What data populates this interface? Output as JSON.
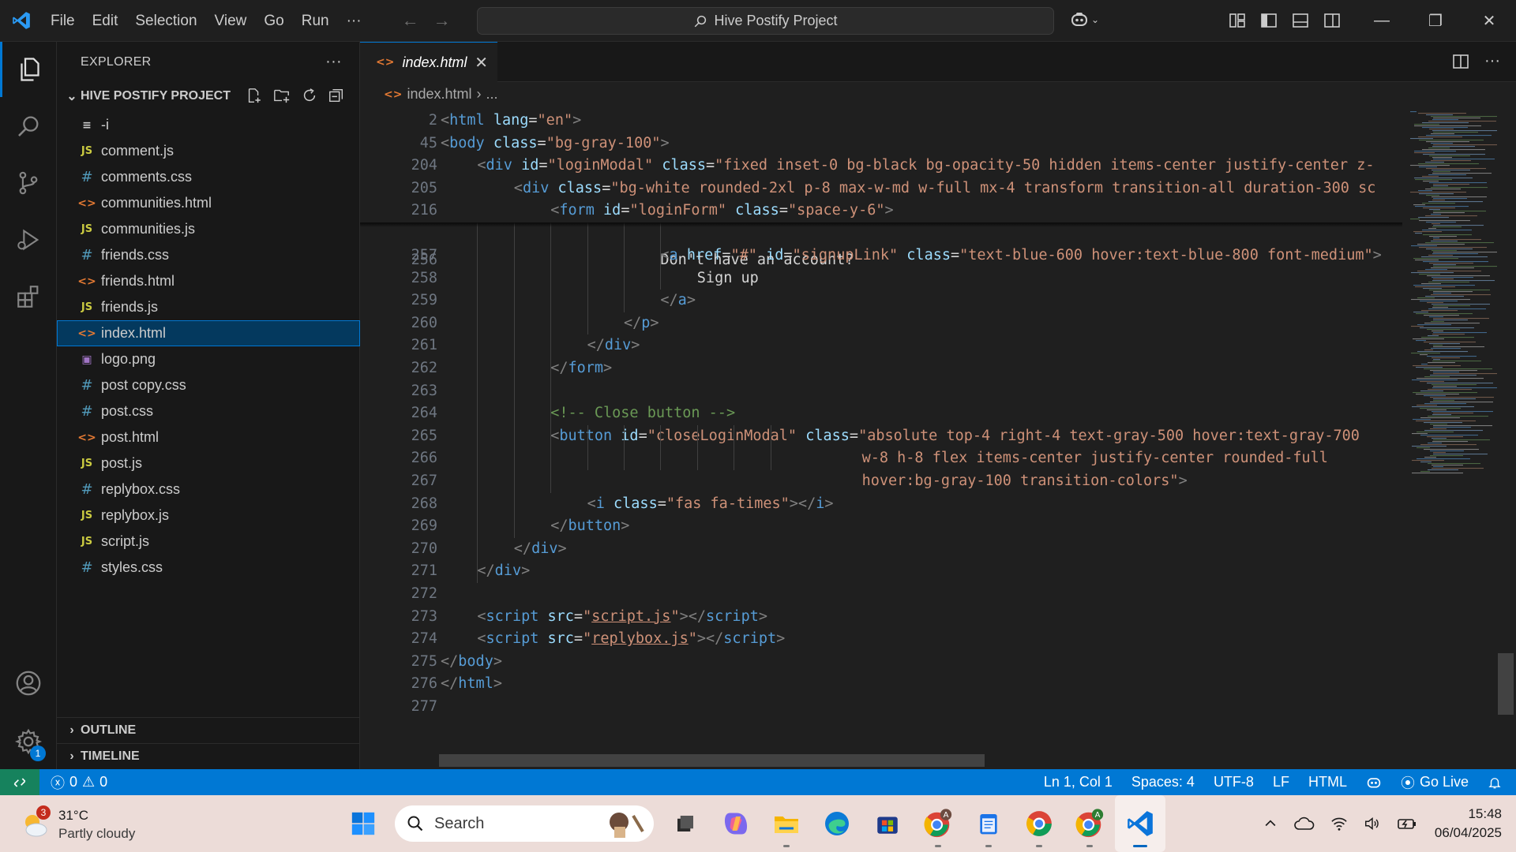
{
  "titlebar": {
    "menu": [
      "File",
      "Edit",
      "Selection",
      "View",
      "Go",
      "Run",
      "···"
    ],
    "command_center": "Hive Postify Project",
    "copilot_icon": "copilot-icon",
    "window_controls": [
      "minimize",
      "restore",
      "close"
    ]
  },
  "activity_bar": {
    "items": [
      "explorer-icon",
      "search-icon",
      "source-control-icon",
      "run-debug-icon",
      "extensions-icon"
    ],
    "bottom": [
      "account-icon",
      "manage-gear-icon"
    ],
    "settings_badge": "1"
  },
  "sidebar": {
    "title": "EXPLORER",
    "more": "···",
    "project": "HIVE POSTIFY PROJECT",
    "files": [
      {
        "name": "-i",
        "type": "txt",
        "icon": "≡"
      },
      {
        "name": "comment.js",
        "type": "js",
        "icon": "JS"
      },
      {
        "name": "comments.css",
        "type": "css",
        "icon": "#"
      },
      {
        "name": "communities.html",
        "type": "html",
        "icon": "<>"
      },
      {
        "name": "communities.js",
        "type": "js",
        "icon": "JS"
      },
      {
        "name": "friends.css",
        "type": "css",
        "icon": "#"
      },
      {
        "name": "friends.html",
        "type": "html",
        "icon": "<>"
      },
      {
        "name": "friends.js",
        "type": "js",
        "icon": "JS"
      },
      {
        "name": "index.html",
        "type": "html",
        "icon": "<>",
        "selected": true
      },
      {
        "name": "logo.png",
        "type": "png",
        "icon": "▣"
      },
      {
        "name": "post copy.css",
        "type": "css",
        "icon": "#"
      },
      {
        "name": "post.css",
        "type": "css",
        "icon": "#"
      },
      {
        "name": "post.html",
        "type": "html",
        "icon": "<>"
      },
      {
        "name": "post.js",
        "type": "js",
        "icon": "JS"
      },
      {
        "name": "replybox.css",
        "type": "css",
        "icon": "#"
      },
      {
        "name": "replybox.js",
        "type": "js",
        "icon": "JS"
      },
      {
        "name": "script.js",
        "type": "js",
        "icon": "JS"
      },
      {
        "name": "styles.css",
        "type": "css",
        "icon": "#"
      }
    ],
    "sections": [
      "OUTLINE",
      "TIMELINE"
    ]
  },
  "editor": {
    "tab": {
      "label": "index.html",
      "icon": "<>",
      "close": "✕"
    },
    "breadcrumb": [
      "index.html",
      "..."
    ],
    "sticky_lines": [
      {
        "n": "2",
        "indent": 0,
        "tokens": [
          [
            "tg",
            "<"
          ],
          [
            "tn",
            "html"
          ],
          [
            "tx",
            " "
          ],
          [
            "an",
            "lang"
          ],
          [
            "tx",
            "="
          ],
          [
            "av",
            "\"en\""
          ],
          [
            "tg",
            ">"
          ]
        ]
      },
      {
        "n": "45",
        "indent": 0,
        "tokens": [
          [
            "tg",
            "<"
          ],
          [
            "tn",
            "body"
          ],
          [
            "tx",
            " "
          ],
          [
            "an",
            "class"
          ],
          [
            "tx",
            "="
          ],
          [
            "av",
            "\"bg-gray-100\""
          ],
          [
            "tg",
            ">"
          ]
        ]
      },
      {
        "n": "204",
        "indent": 1,
        "tokens": [
          [
            "tg",
            "<"
          ],
          [
            "tn",
            "div"
          ],
          [
            "tx",
            " "
          ],
          [
            "an",
            "id"
          ],
          [
            "tx",
            "="
          ],
          [
            "av",
            "\"loginModal\""
          ],
          [
            "tx",
            " "
          ],
          [
            "an",
            "class"
          ],
          [
            "tx",
            "="
          ],
          [
            "av",
            "\"fixed inset-0 bg-black bg-opacity-50 hidden items-center justify-center z-"
          ]
        ]
      },
      {
        "n": "205",
        "indent": 2,
        "tokens": [
          [
            "tg",
            "<"
          ],
          [
            "tn",
            "div"
          ],
          [
            "tx",
            " "
          ],
          [
            "an",
            "class"
          ],
          [
            "tx",
            "="
          ],
          [
            "av",
            "\"bg-white rounded-2xl p-8 max-w-md w-full mx-4 transform transition-all duration-300 sc"
          ]
        ]
      },
      {
        "n": "216",
        "indent": 3,
        "tokens": [
          [
            "tg",
            "<"
          ],
          [
            "tn",
            "form"
          ],
          [
            "tx",
            " "
          ],
          [
            "an",
            "id"
          ],
          [
            "tx",
            "="
          ],
          [
            "av",
            "\"loginForm\""
          ],
          [
            "tx",
            " "
          ],
          [
            "an",
            "class"
          ],
          [
            "tx",
            "="
          ],
          [
            "av",
            "\"space-y-6\""
          ],
          [
            "tg",
            ">"
          ]
        ]
      }
    ],
    "partial_line": {
      "n": "256",
      "text": "Don't have an account?"
    },
    "lines": [
      {
        "n": "257",
        "indent": 6,
        "tokens": [
          [
            "tg",
            "<"
          ],
          [
            "tn",
            "a"
          ],
          [
            "tx",
            " "
          ],
          [
            "an",
            "href"
          ],
          [
            "tx",
            "="
          ],
          [
            "av",
            "\"#\""
          ],
          [
            "tx",
            " "
          ],
          [
            "an",
            "id"
          ],
          [
            "tx",
            "="
          ],
          [
            "av",
            "\"signupLink\""
          ],
          [
            "tx",
            " "
          ],
          [
            "an",
            "class"
          ],
          [
            "tx",
            "="
          ],
          [
            "av",
            "\"text-blue-600 hover:text-blue-800 font-medium\""
          ],
          [
            "tg",
            ">"
          ]
        ]
      },
      {
        "n": "258",
        "indent": 7,
        "tokens": [
          [
            "tx",
            "Sign up"
          ]
        ]
      },
      {
        "n": "259",
        "indent": 6,
        "tokens": [
          [
            "tg",
            "</"
          ],
          [
            "tn",
            "a"
          ],
          [
            "tg",
            ">"
          ]
        ]
      },
      {
        "n": "260",
        "indent": 5,
        "tokens": [
          [
            "tg",
            "</"
          ],
          [
            "tn",
            "p"
          ],
          [
            "tg",
            ">"
          ]
        ]
      },
      {
        "n": "261",
        "indent": 4,
        "tokens": [
          [
            "tg",
            "</"
          ],
          [
            "tn",
            "div"
          ],
          [
            "tg",
            ">"
          ]
        ]
      },
      {
        "n": "262",
        "indent": 3,
        "tokens": [
          [
            "tg",
            "</"
          ],
          [
            "tn",
            "form"
          ],
          [
            "tg",
            ">"
          ]
        ]
      },
      {
        "n": "263",
        "indent": 0,
        "tokens": []
      },
      {
        "n": "264",
        "indent": 3,
        "tokens": [
          [
            "cm",
            "<!-- Close button -->"
          ]
        ]
      },
      {
        "n": "265",
        "indent": 3,
        "tokens": [
          [
            "tg",
            "<"
          ],
          [
            "tn",
            "button"
          ],
          [
            "tx",
            " "
          ],
          [
            "an",
            "id"
          ],
          [
            "tx",
            "="
          ],
          [
            "av",
            "\"closeLoginModal\""
          ],
          [
            "tx",
            " "
          ],
          [
            "an",
            "class"
          ],
          [
            "tx",
            "="
          ],
          [
            "av",
            "\"absolute top-4 right-4 text-gray-500 hover:text-gray-700"
          ]
        ]
      },
      {
        "n": "266",
        "indent": 0,
        "pad": 23,
        "tokens": [
          [
            "av",
            "w-8 h-8 flex items-center justify-center rounded-full"
          ]
        ]
      },
      {
        "n": "267",
        "indent": 0,
        "pad": 23,
        "tokens": [
          [
            "av",
            "hover:bg-gray-100 transition-colors\""
          ],
          [
            "tg",
            ">"
          ]
        ]
      },
      {
        "n": "268",
        "indent": 4,
        "tokens": [
          [
            "tg",
            "<"
          ],
          [
            "tn",
            "i"
          ],
          [
            "tx",
            " "
          ],
          [
            "an",
            "class"
          ],
          [
            "tx",
            "="
          ],
          [
            "av",
            "\"fas fa-times\""
          ],
          [
            "tg",
            "></"
          ],
          [
            "tn",
            "i"
          ],
          [
            "tg",
            ">"
          ]
        ]
      },
      {
        "n": "269",
        "indent": 3,
        "tokens": [
          [
            "tg",
            "</"
          ],
          [
            "tn",
            "button"
          ],
          [
            "tg",
            ">"
          ]
        ]
      },
      {
        "n": "270",
        "indent": 2,
        "tokens": [
          [
            "tg",
            "</"
          ],
          [
            "tn",
            "div"
          ],
          [
            "tg",
            ">"
          ]
        ]
      },
      {
        "n": "271",
        "indent": 1,
        "tokens": [
          [
            "tg",
            "</"
          ],
          [
            "tn",
            "div"
          ],
          [
            "tg",
            ">"
          ]
        ]
      },
      {
        "n": "272",
        "indent": 0,
        "tokens": []
      },
      {
        "n": "273",
        "indent": 1,
        "tokens": [
          [
            "tg",
            "<"
          ],
          [
            "tn",
            "script"
          ],
          [
            "tx",
            " "
          ],
          [
            "an",
            "src"
          ],
          [
            "tx",
            "="
          ],
          [
            "av",
            "\""
          ],
          [
            "avu",
            "script.js"
          ],
          [
            "av",
            "\""
          ],
          [
            "tg",
            "></"
          ],
          [
            "tn",
            "script"
          ],
          [
            "tg",
            ">"
          ]
        ]
      },
      {
        "n": "274",
        "indent": 1,
        "tokens": [
          [
            "tg",
            "<"
          ],
          [
            "tn",
            "script"
          ],
          [
            "tx",
            " "
          ],
          [
            "an",
            "src"
          ],
          [
            "tx",
            "="
          ],
          [
            "av",
            "\""
          ],
          [
            "avu",
            "replybox.js"
          ],
          [
            "av",
            "\""
          ],
          [
            "tg",
            "></"
          ],
          [
            "tn",
            "script"
          ],
          [
            "tg",
            ">"
          ]
        ]
      },
      {
        "n": "275",
        "indent": 0,
        "tokens": [
          [
            "tg",
            "</"
          ],
          [
            "tn",
            "body"
          ],
          [
            "tg",
            ">"
          ]
        ]
      },
      {
        "n": "276",
        "indent": 0,
        "tokens": [
          [
            "tg",
            "</"
          ],
          [
            "tn",
            "html"
          ],
          [
            "tg",
            ">"
          ]
        ]
      },
      {
        "n": "277",
        "indent": 0,
        "tokens": []
      }
    ]
  },
  "statusbar": {
    "errors": "0",
    "warnings": "0",
    "position": "Ln 1, Col 1",
    "spaces": "Spaces: 4",
    "encoding": "UTF-8",
    "eol": "LF",
    "language": "HTML",
    "go_live": "Go Live"
  },
  "taskbar": {
    "weather": {
      "temp": "31°C",
      "desc": "Partly cloudy",
      "badge": "3"
    },
    "search_placeholder": "Search",
    "apps": [
      "task-view-icon",
      "copilot-app-icon",
      "file-explorer-icon",
      "edge-icon",
      "store-icon",
      "chrome-profile-a-icon",
      "notepad-icon",
      "chrome-icon",
      "chrome-profile-green-icon",
      "vscode-icon"
    ],
    "time": "15:48",
    "date": "06/04/2025"
  },
  "colors": {
    "accent": "#0078d4",
    "remote": "#16825d",
    "selected_bg": "#04395e",
    "editor_bg": "#1f1f1f",
    "sidebar_bg": "#181818"
  }
}
